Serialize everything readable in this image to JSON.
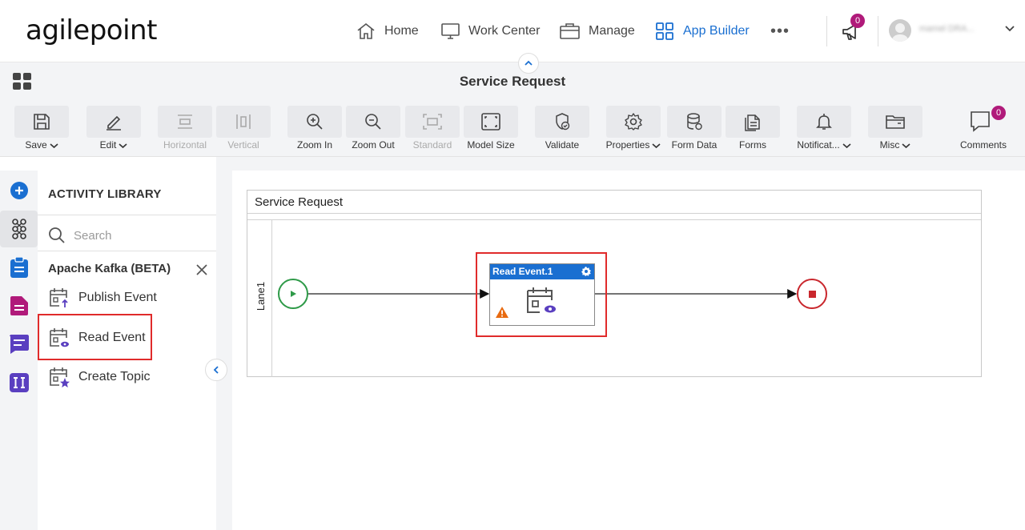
{
  "brand": {
    "logo_text": "agilepoint"
  },
  "nav": {
    "items": [
      {
        "label": "Home",
        "icon": "home-icon"
      },
      {
        "label": "Work Center",
        "icon": "monitor-icon"
      },
      {
        "label": "Manage",
        "icon": "briefcase-icon"
      },
      {
        "label": "App Builder",
        "icon": "grid-icon",
        "active": true
      }
    ],
    "more": "•••",
    "notifications_count": "0",
    "user_name": "mamel DRA..."
  },
  "titlebar": {
    "title": "Service Request"
  },
  "toolbar": {
    "items": [
      {
        "label": "Save",
        "dropdown": true,
        "enabled": true
      },
      {
        "label": "Edit",
        "dropdown": true,
        "enabled": true
      },
      {
        "label": "Horizontal",
        "enabled": false
      },
      {
        "label": "Vertical",
        "enabled": false
      },
      {
        "label": "Zoom In",
        "enabled": true
      },
      {
        "label": "Zoom Out",
        "enabled": true
      },
      {
        "label": "Standard",
        "enabled": false
      },
      {
        "label": "Model Size",
        "enabled": true
      },
      {
        "label": "Validate",
        "enabled": true
      },
      {
        "label": "Properties",
        "dropdown": true,
        "enabled": true
      },
      {
        "label": "Form Data",
        "enabled": true
      },
      {
        "label": "Forms",
        "enabled": true
      },
      {
        "label": "Notificat...",
        "dropdown": true,
        "enabled": true
      },
      {
        "label": "Misc",
        "dropdown": true,
        "enabled": true
      }
    ],
    "comments_label": "Comments",
    "comments_count": "0"
  },
  "library": {
    "heading": "ACTIVITY LIBRARY",
    "search_placeholder": "Search",
    "category": "Apache Kafka (BETA)",
    "activities": [
      {
        "label": "Publish Event",
        "icon": "publish-event-icon"
      },
      {
        "label": "Read Event",
        "icon": "read-event-icon",
        "highlighted": true
      },
      {
        "label": "Create Topic",
        "icon": "create-topic-icon"
      }
    ]
  },
  "canvas": {
    "pool_title": "Service Request",
    "lane_label": "Lane1",
    "activity_node": {
      "title": "Read Event.1",
      "has_warning": true
    }
  },
  "colors": {
    "accent_blue": "#1a6fd1",
    "highlight_red": "#e02b2b",
    "start_green": "#2e9a48",
    "end_red": "#c9272d",
    "badge_magenta": "#b01a7a"
  }
}
